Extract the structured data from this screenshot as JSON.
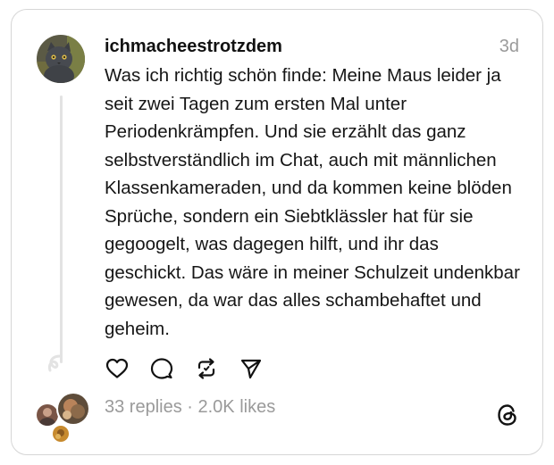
{
  "post": {
    "username": "ichmacheestrotzdem",
    "time": "3d",
    "text": "Was ich richtig schön finde: Meine Maus leider ja seit zwei Tagen zum ersten Mal unter Periodenkrämpfen. Und sie erzählt das ganz selbstverständlich im Chat, auch mit männlichen Klassenkameraden, und da kommen keine blöden Sprüche, sondern ein Siebtklässler hat für sie gegoogelt, was dagegen hilft, und ihr das geschickt. Das wäre in meiner Schulzeit undenkbar gewesen, da war das alles schambehaftet und geheim."
  },
  "actions": {
    "like_icon": "heart-icon",
    "reply_icon": "comment-icon",
    "repost_icon": "repost-icon",
    "share_icon": "send-icon"
  },
  "stats": {
    "replies_likes": "33 replies · 2.0K likes"
  },
  "branding": {
    "logo_icon": "threads-logo-icon"
  },
  "colors": {
    "muted_text": "#9a9a9a",
    "border": "#d6d6d6"
  }
}
